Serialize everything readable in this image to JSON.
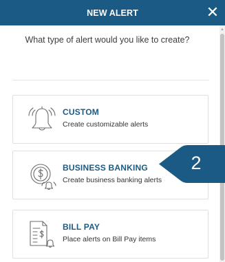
{
  "dialog": {
    "title": "NEW ALERT",
    "close_label": "✕",
    "question": "What type of alert would you like to create?"
  },
  "options": [
    {
      "title": "CUSTOM",
      "description": "Create customizable alerts",
      "icon": "bell-icon"
    },
    {
      "title": "BUSINESS BANKING",
      "description": "Create business banking alerts",
      "icon": "dollar-coin-bell-icon"
    },
    {
      "title": "BILL PAY",
      "description": "Place alerts on Bill Pay items",
      "icon": "bill-dollar-bell-icon"
    }
  ],
  "callout": {
    "number": "2"
  },
  "colors": {
    "header_bg": "#1a5a84",
    "title_accent": "#1a5a84",
    "callout_bg": "#1a5a84"
  }
}
